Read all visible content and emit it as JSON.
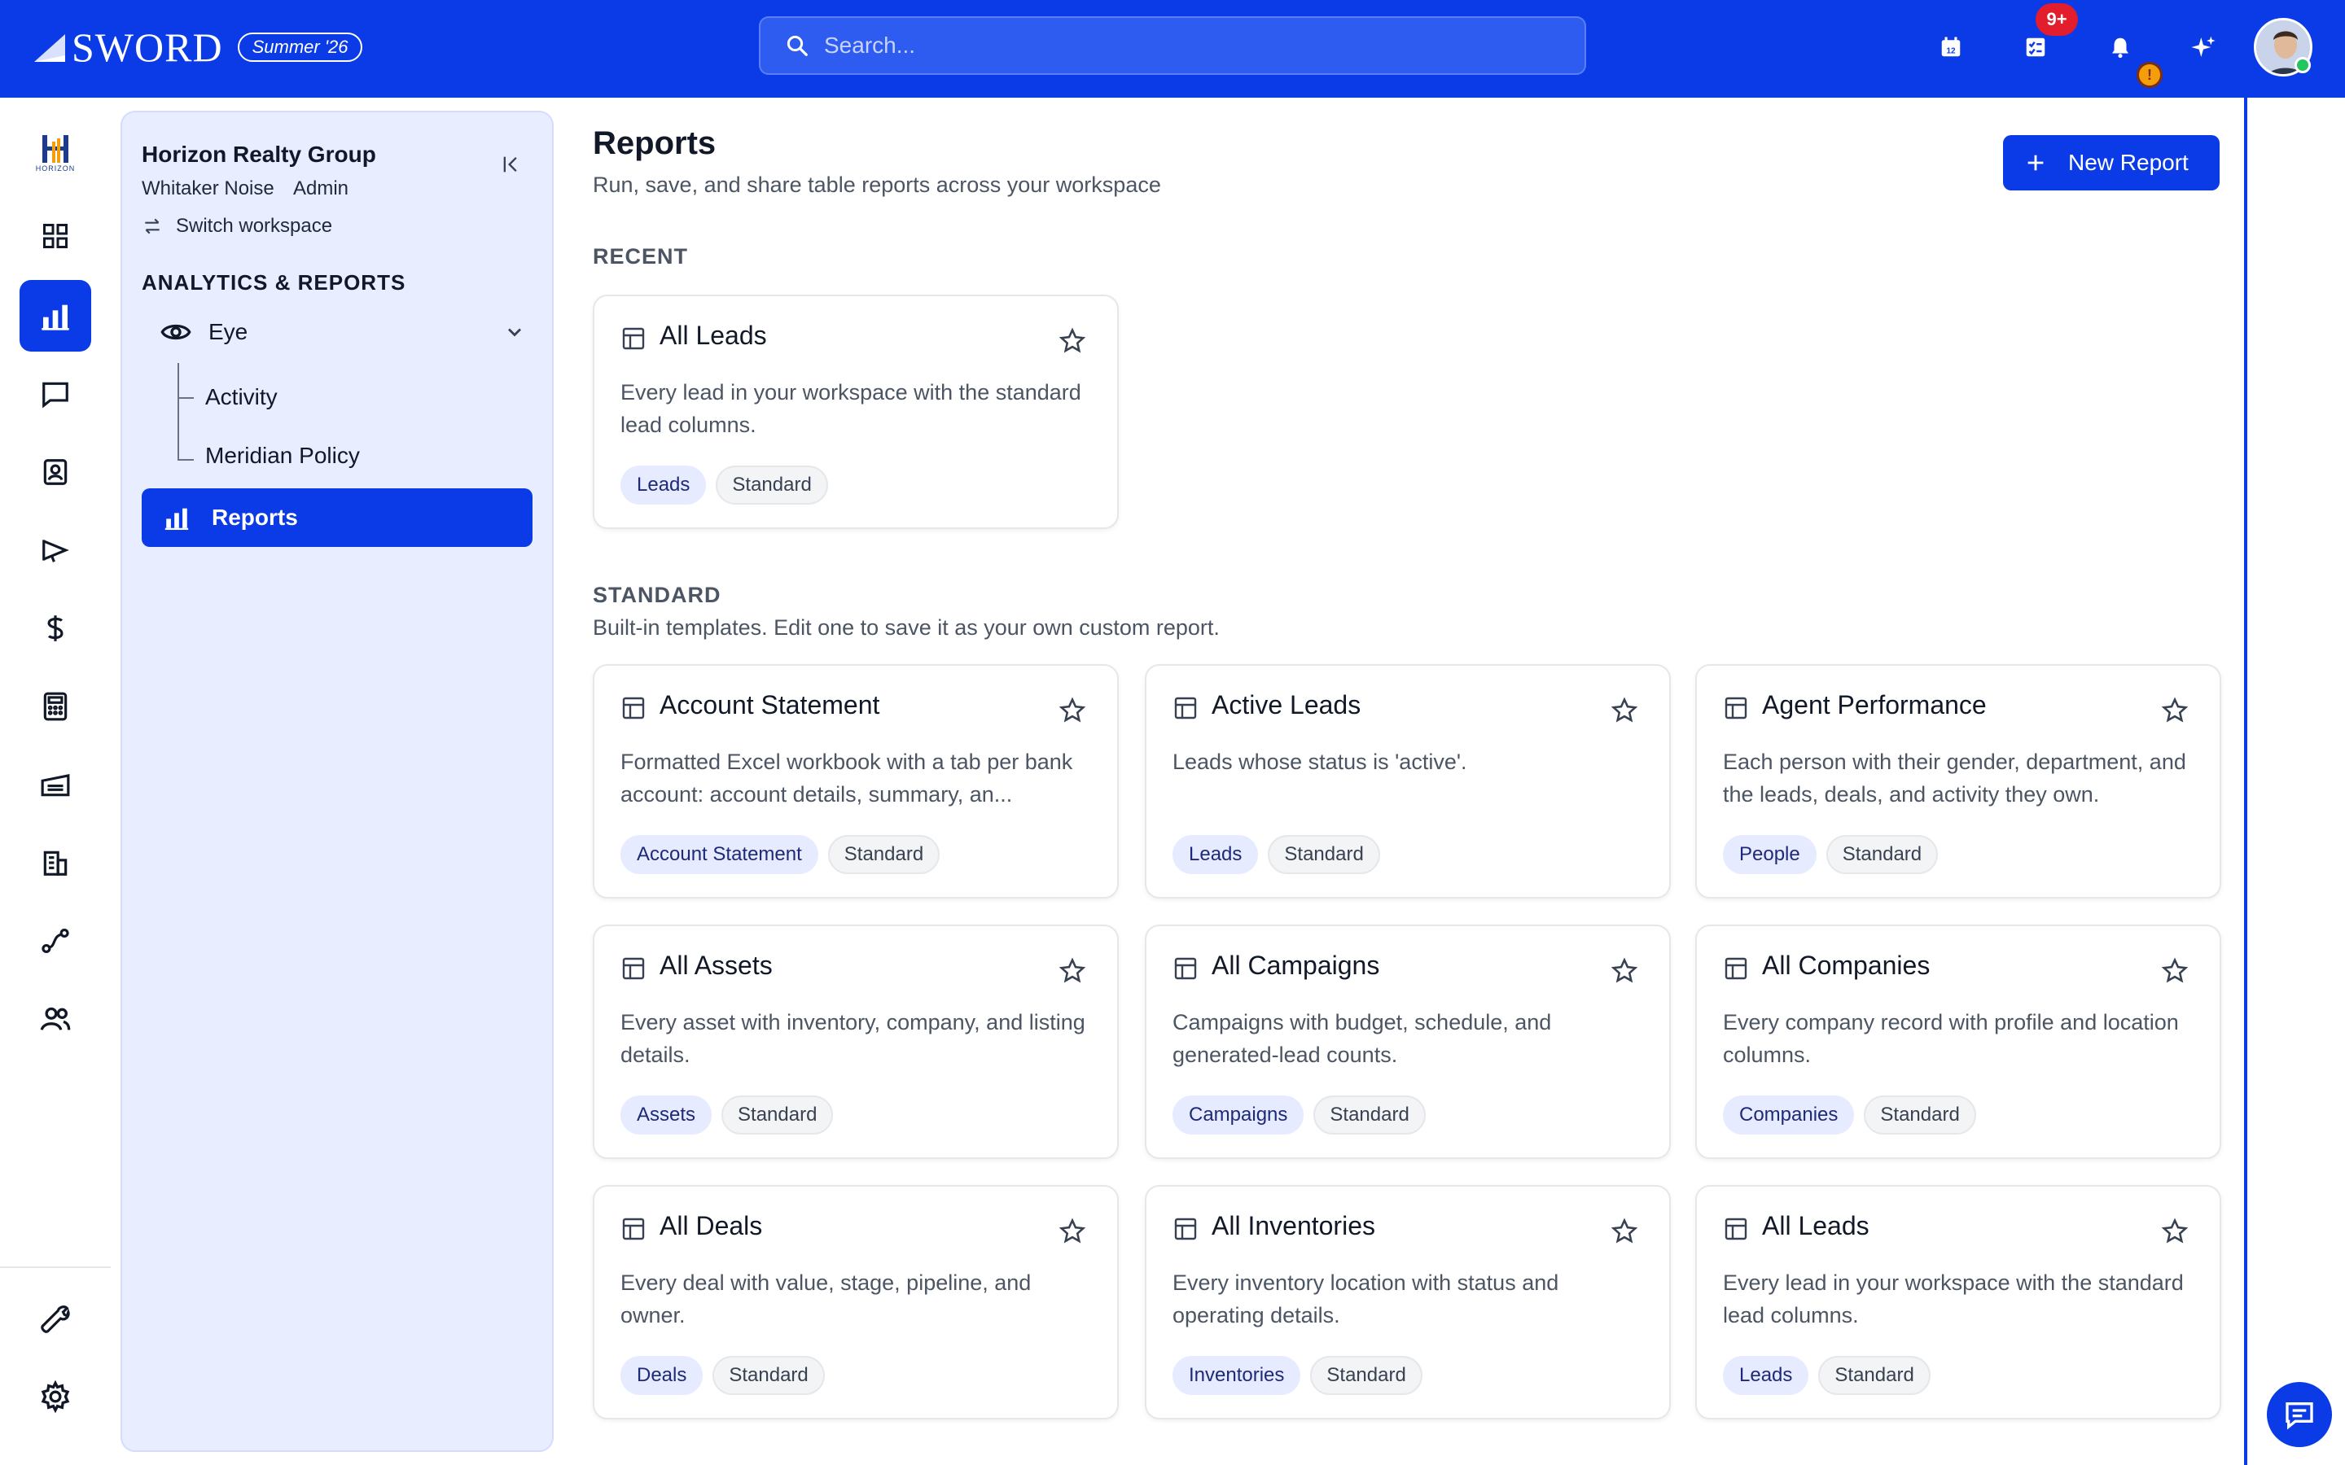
{
  "header": {
    "logo_text": "SWORD",
    "release_badge": "Summer '26",
    "search_placeholder": "Search...",
    "notifications_badge": "9+",
    "warning_badge": "!"
  },
  "workspace": {
    "name": "Horizon Realty Group",
    "user": "Whitaker Noise",
    "role": "Admin",
    "switch_label": "Switch workspace",
    "logo_text": "HORIZON"
  },
  "sidebar": {
    "section_title": "ANALYTICS & REPORTS",
    "group_label": "Eye",
    "sub_items": [
      {
        "label": "Activity"
      },
      {
        "label": "Meridian Policy"
      }
    ],
    "active_item": "Reports"
  },
  "main": {
    "title": "Reports",
    "subtitle": "Run, save, and share table reports across your workspace",
    "new_report_label": "New Report",
    "recent_heading": "RECENT",
    "standard_heading": "STANDARD",
    "standard_desc": "Built-in templates. Edit one to save it as your own custom report."
  },
  "recent_cards": [
    {
      "title": "All Leads",
      "desc": "Every lead in your workspace with the standard lead columns.",
      "tag": "Leads",
      "kind": "Standard"
    }
  ],
  "standard_cards": [
    {
      "title": "Account Statement",
      "desc": "Formatted Excel workbook with a tab per bank account: account details, summary, an...",
      "tag": "Account Statement",
      "kind": "Standard"
    },
    {
      "title": "Active Leads",
      "desc": "Leads whose status is 'active'.",
      "tag": "Leads",
      "kind": "Standard"
    },
    {
      "title": "Agent Performance",
      "desc": "Each person with their gender, department, and the leads, deals, and activity they own.",
      "tag": "People",
      "kind": "Standard"
    },
    {
      "title": "All Assets",
      "desc": "Every asset with inventory, company, and listing details.",
      "tag": "Assets",
      "kind": "Standard"
    },
    {
      "title": "All Campaigns",
      "desc": "Campaigns with budget, schedule, and generated-lead counts.",
      "tag": "Campaigns",
      "kind": "Standard"
    },
    {
      "title": "All Companies",
      "desc": "Every company record with profile and location columns.",
      "tag": "Companies",
      "kind": "Standard"
    },
    {
      "title": "All Deals",
      "desc": "Every deal with value, stage, pipeline, and owner.",
      "tag": "Deals",
      "kind": "Standard"
    },
    {
      "title": "All Inventories",
      "desc": "Every inventory location with status and operating details.",
      "tag": "Inventories",
      "kind": "Standard"
    },
    {
      "title": "All Leads",
      "desc": "Every lead in your workspace with the standard lead columns.",
      "tag": "Leads",
      "kind": "Standard"
    }
  ],
  "colors": {
    "brand": "#0a3be6",
    "panel_bg": "#e8edff",
    "tag_bg": "#e6ebff",
    "badge_red": "#e11d2e"
  }
}
